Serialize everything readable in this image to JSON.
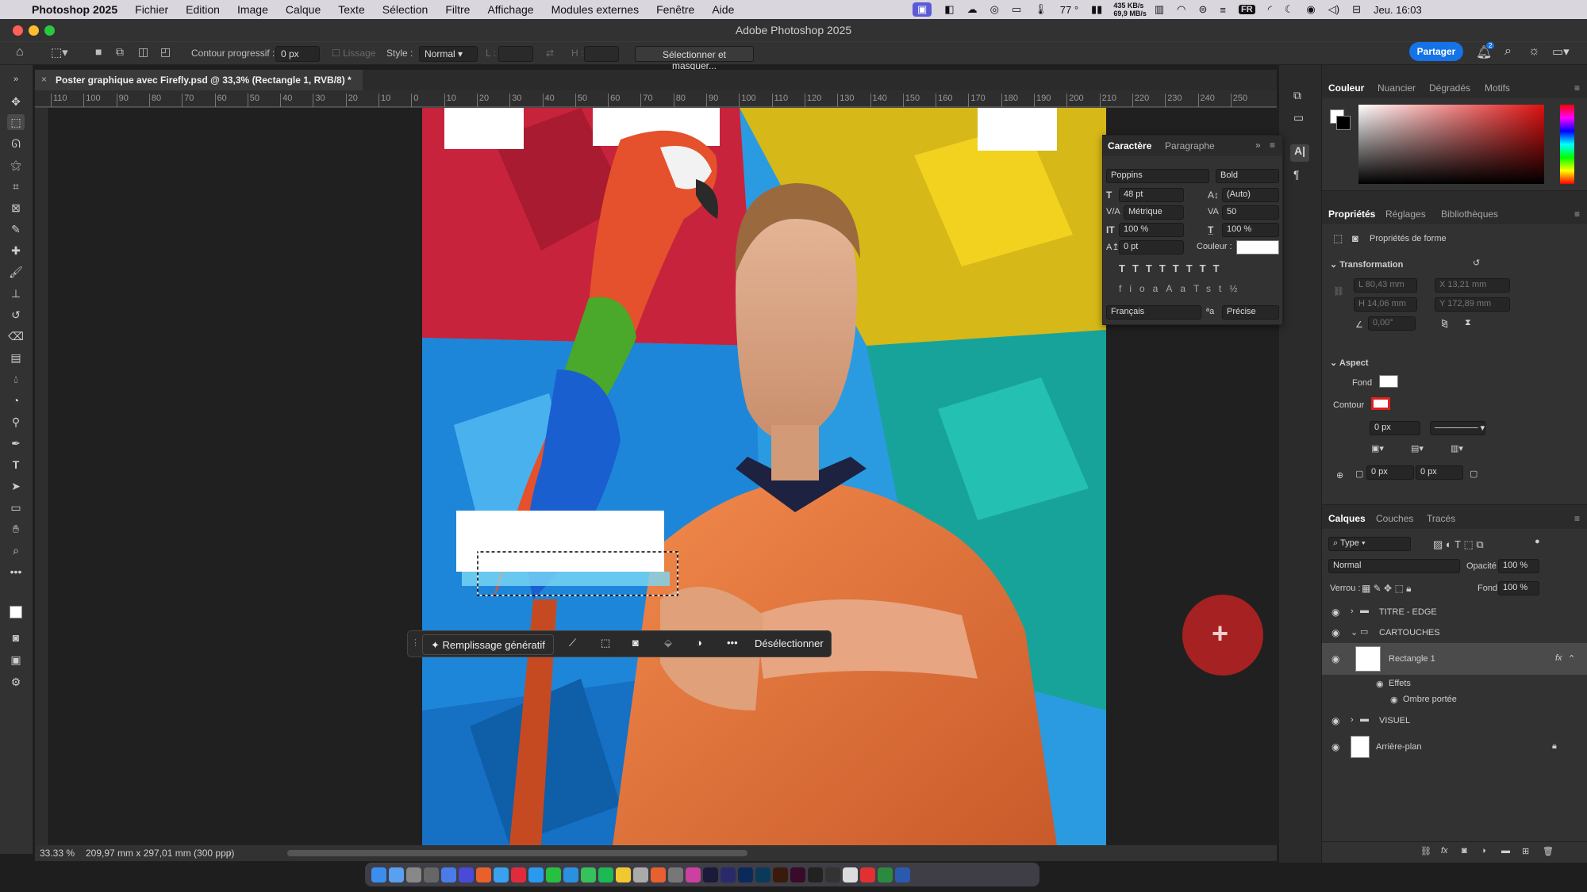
{
  "menubar": {
    "app": "Photoshop 2025",
    "items": [
      "Fichier",
      "Edition",
      "Image",
      "Calque",
      "Texte",
      "Sélection",
      "Filtre",
      "Affichage",
      "Modules externes",
      "Fenêtre",
      "Aide"
    ],
    "temp": "77 °",
    "net_up": "435 KB/s",
    "net_down": "69,9 MB/s",
    "lang": "FR",
    "clock": "Jeu. 16:03"
  },
  "window": {
    "title": "Adobe Photoshop 2025"
  },
  "options": {
    "feather_label": "Contour progressif :",
    "feather_value": "0 px",
    "antialias": "Lissage",
    "style_label": "Style :",
    "style_value": "Normal",
    "w_label": "L :",
    "h_label": "H :",
    "select_mask": "Sélectionner et masquer...",
    "share": "Partager",
    "notif_count": "2"
  },
  "document": {
    "tab": "Poster graphique avec Firefly.psd @ 33,3% (Rectangle 1, RVB/8) *"
  },
  "ruler": {
    "h_ticks": [
      "110",
      "100",
      "90",
      "80",
      "70",
      "60",
      "50",
      "40",
      "30",
      "20",
      "10",
      "0",
      "10",
      "20",
      "30",
      "40",
      "50",
      "60",
      "70",
      "80",
      "90",
      "100",
      "110",
      "120",
      "130",
      "140",
      "150",
      "160",
      "170",
      "180",
      "190",
      "200",
      "210",
      "220",
      "230",
      "240",
      "250"
    ]
  },
  "status": {
    "zoom": "33.33 %",
    "doc_size": "209,97 mm x 297,01 mm (300 ppp)"
  },
  "contextbar": {
    "generative": "Remplissage génératif",
    "deselect": "Désélectionner"
  },
  "character": {
    "tabs": [
      "Caractère",
      "Paragraphe"
    ],
    "font": "Poppins",
    "weight": "Bold",
    "size": "48 pt",
    "leading": "(Auto)",
    "kerning": "Métrique",
    "tracking": "50",
    "vscale": "100 %",
    "hscale": "100 %",
    "baseline": "0 pt",
    "color_label": "Couleur :",
    "language": "Français",
    "aa": "Précise"
  },
  "color_panel": {
    "tabs": [
      "Couleur",
      "Nuancier",
      "Dégradés",
      "Motifs"
    ]
  },
  "properties": {
    "tabs": [
      "Propriétés",
      "Réglages",
      "Bibliothèques"
    ],
    "title": "Propriétés de forme",
    "transform": "Transformation",
    "w": "L 80,43 mm",
    "x": "X 13,21 mm",
    "h": "H 14,06 mm",
    "y": "Y 172,89 mm",
    "angle": "0,00°",
    "aspect": "Aspect",
    "fill": "Fond",
    "stroke": "Contour",
    "stroke_width": "0 px",
    "px1": "0 px",
    "px2": "0 px"
  },
  "layers": {
    "tabs": [
      "Calques",
      "Couches",
      "Tracés"
    ],
    "filter": "Type",
    "blend": "Normal",
    "opacity_label": "Opacité :",
    "opacity": "100 %",
    "lock_label": "Verrou :",
    "fill_label": "Fond :",
    "fill": "100 %",
    "items": [
      {
        "name": "TITRE - EDGE",
        "type": "group"
      },
      {
        "name": "CARTOUCHES",
        "type": "group"
      },
      {
        "name": "Rectangle 1",
        "type": "layer"
      },
      {
        "name": "Effets",
        "type": "effect"
      },
      {
        "name": "Ombre portée",
        "type": "effect"
      },
      {
        "name": "VISUEL",
        "type": "group"
      },
      {
        "name": "Arrière-plan",
        "type": "layer"
      }
    ]
  },
  "colors": {
    "accent": "#1473e6",
    "panel": "#323232",
    "dark": "#1e1e1e",
    "stroke_red": "#e02020"
  }
}
